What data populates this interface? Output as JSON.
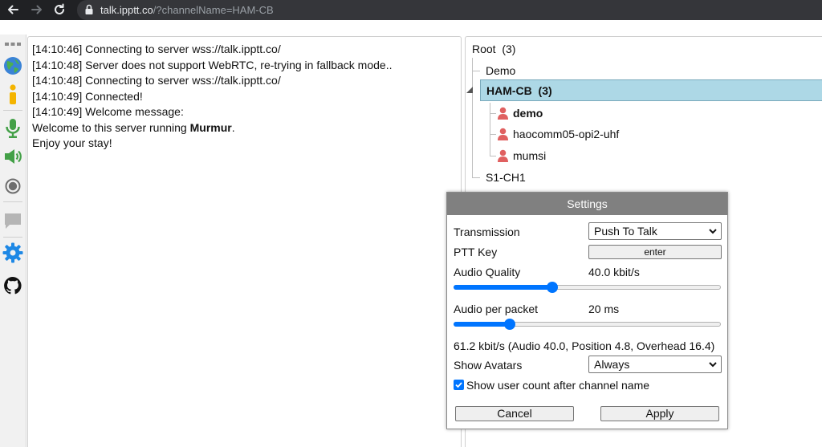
{
  "browser": {
    "url_host": "talk.ipptt.co",
    "url_path": "/?channelName=HAM-CB"
  },
  "toolbar": {
    "icons": [
      "more-icon",
      "globe-icon",
      "info-icon",
      "microphone-icon",
      "speaker-icon",
      "record-icon",
      "chat-icon",
      "settings-icon",
      "github-icon"
    ]
  },
  "chat": {
    "lines": [
      "[14:10:46] Connecting to server wss://talk.ipptt.co/",
      "[14:10:48] Server does not support WebRTC, re-trying in fallback mode..",
      "[14:10:48] Connecting to server wss://talk.ipptt.co/",
      "[14:10:49] Connected!",
      "[14:10:49] Welcome message:"
    ],
    "welcome_prefix": "Welcome to this server running ",
    "welcome_server": "Murmur",
    "welcome_suffix": ".",
    "enjoy": "Enjoy your stay!"
  },
  "tree": {
    "root_label": "Root",
    "root_count": "(3)",
    "channels": {
      "demo": "Demo",
      "selected_name": "HAM-CB",
      "selected_count": "(3)",
      "s1": "S1-CH1"
    },
    "users": [
      "demo",
      "haocomm05-opi2-uhf",
      "mumsi"
    ],
    "user_color": "#e06060"
  },
  "settings": {
    "title": "Settings",
    "transmission_label": "Transmission",
    "transmission_value": "Push To Talk",
    "ptt_key_label": "PTT Key",
    "ptt_key_value": "enter",
    "audio_quality_label": "Audio Quality",
    "audio_quality_value": "40.0 kbit/s",
    "audio_quality_fraction": 0.37,
    "audio_packet_label": "Audio per packet",
    "audio_packet_value": "20 ms",
    "audio_packet_fraction": 0.21,
    "bitrate_summary": "61.2 kbit/s (Audio 40.0, Position 4.8, Overhead 16.4)",
    "show_avatars_label": "Show Avatars",
    "show_avatars_value": "Always",
    "show_user_count_label": "Show user count after channel name",
    "show_user_count_checked": true,
    "cancel_label": "Cancel",
    "apply_label": "Apply",
    "accent_color": "#0075ff"
  }
}
